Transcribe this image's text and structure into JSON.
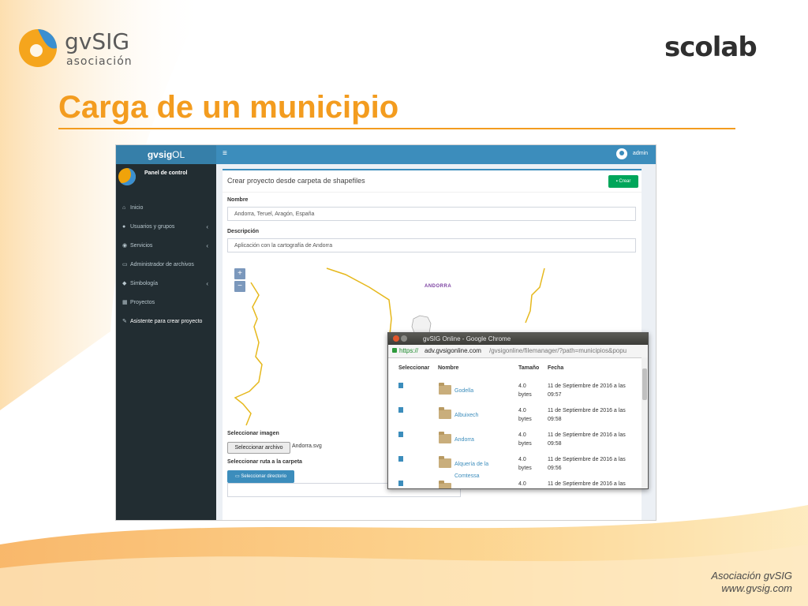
{
  "colors": {
    "accent": "#f39c1f",
    "sidebar": "#222d32",
    "header": "#3c8dbc",
    "success": "#00a65a"
  },
  "logo_gvsig": {
    "name": "gvSIG",
    "sub": "asociación"
  },
  "logo_scolab": {
    "name": "scolab"
  },
  "slide": {
    "title": "Carga de un municipio"
  },
  "footer": {
    "org": "Asociación gvSIG",
    "url": "www.gvsig.com"
  },
  "app": {
    "brand_bold": "gvsig",
    "brand_rest": "OL",
    "user_panel": "Panel de control",
    "admin": "admin",
    "sidebar": [
      {
        "icon": "home-icon",
        "glyph": "⌂",
        "label": "Inicio",
        "chevron": ""
      },
      {
        "icon": "users-icon",
        "glyph": "●",
        "label": "Usuarios y grupos",
        "chevron": "‹"
      },
      {
        "icon": "globe-icon",
        "glyph": "◉",
        "label": "Servicios",
        "chevron": "‹"
      },
      {
        "icon": "folder-open-icon",
        "glyph": "▭",
        "label": "Administrador de archivos",
        "chevron": ""
      },
      {
        "icon": "tags-icon",
        "glyph": "◆",
        "label": "Simbología",
        "chevron": "‹"
      },
      {
        "icon": "cubes-icon",
        "glyph": "▦",
        "label": "Proyectos",
        "chevron": ""
      },
      {
        "icon": "magic-icon",
        "glyph": "✎",
        "label": "Asistente para crear proyecto",
        "chevron": ""
      }
    ]
  },
  "form": {
    "box_title": "Crear proyecto desde carpeta de shapefiles",
    "create_btn": "Crear",
    "name_label": "Nombre",
    "name_value": "Andorra, Teruel, Aragón, España",
    "desc_label": "Descripción",
    "desc_value": "Aplicación con la cartografía de Andorra",
    "zoom_in": "+",
    "zoom_out": "−",
    "map_label": "ANDORRA",
    "image_label": "Seleccionar imagen",
    "file_btn": "Seleccionar archivo",
    "file_name": "Andorra.svg",
    "path_label": "Seleccionar ruta a la carpeta",
    "dir_btn": "Seleccionar directorio"
  },
  "popup": {
    "title": "gvSIG Online - Google Chrome",
    "url_https": "https://",
    "url_host": "adv.gvsigonline.com",
    "url_path": "/gvsigonline/filemanager/?path=municipios&popu",
    "headers": {
      "select": "Seleccionar",
      "name": "Nombre",
      "size": "Tamaño",
      "date": "Fecha"
    },
    "rows": [
      {
        "name": "Godella",
        "size": "4.0 bytes",
        "date": "11 de Septiembre de 2016 a las 09:57"
      },
      {
        "name": "Albuixech",
        "size": "4.0 bytes",
        "date": "11 de Septiembre de 2016 a las 09:58"
      },
      {
        "name": "Andorra",
        "size": "4.0 bytes",
        "date": "11 de Septiembre de 2016 a las 09:58"
      },
      {
        "name": "Alquería de la Comtessa",
        "size": "4.0 bytes",
        "date": "11 de Septiembre de 2016 a las 09:56"
      },
      {
        "name": "",
        "size": "4.0",
        "date": "11 de Septiembre de 2016 a las"
      }
    ]
  }
}
